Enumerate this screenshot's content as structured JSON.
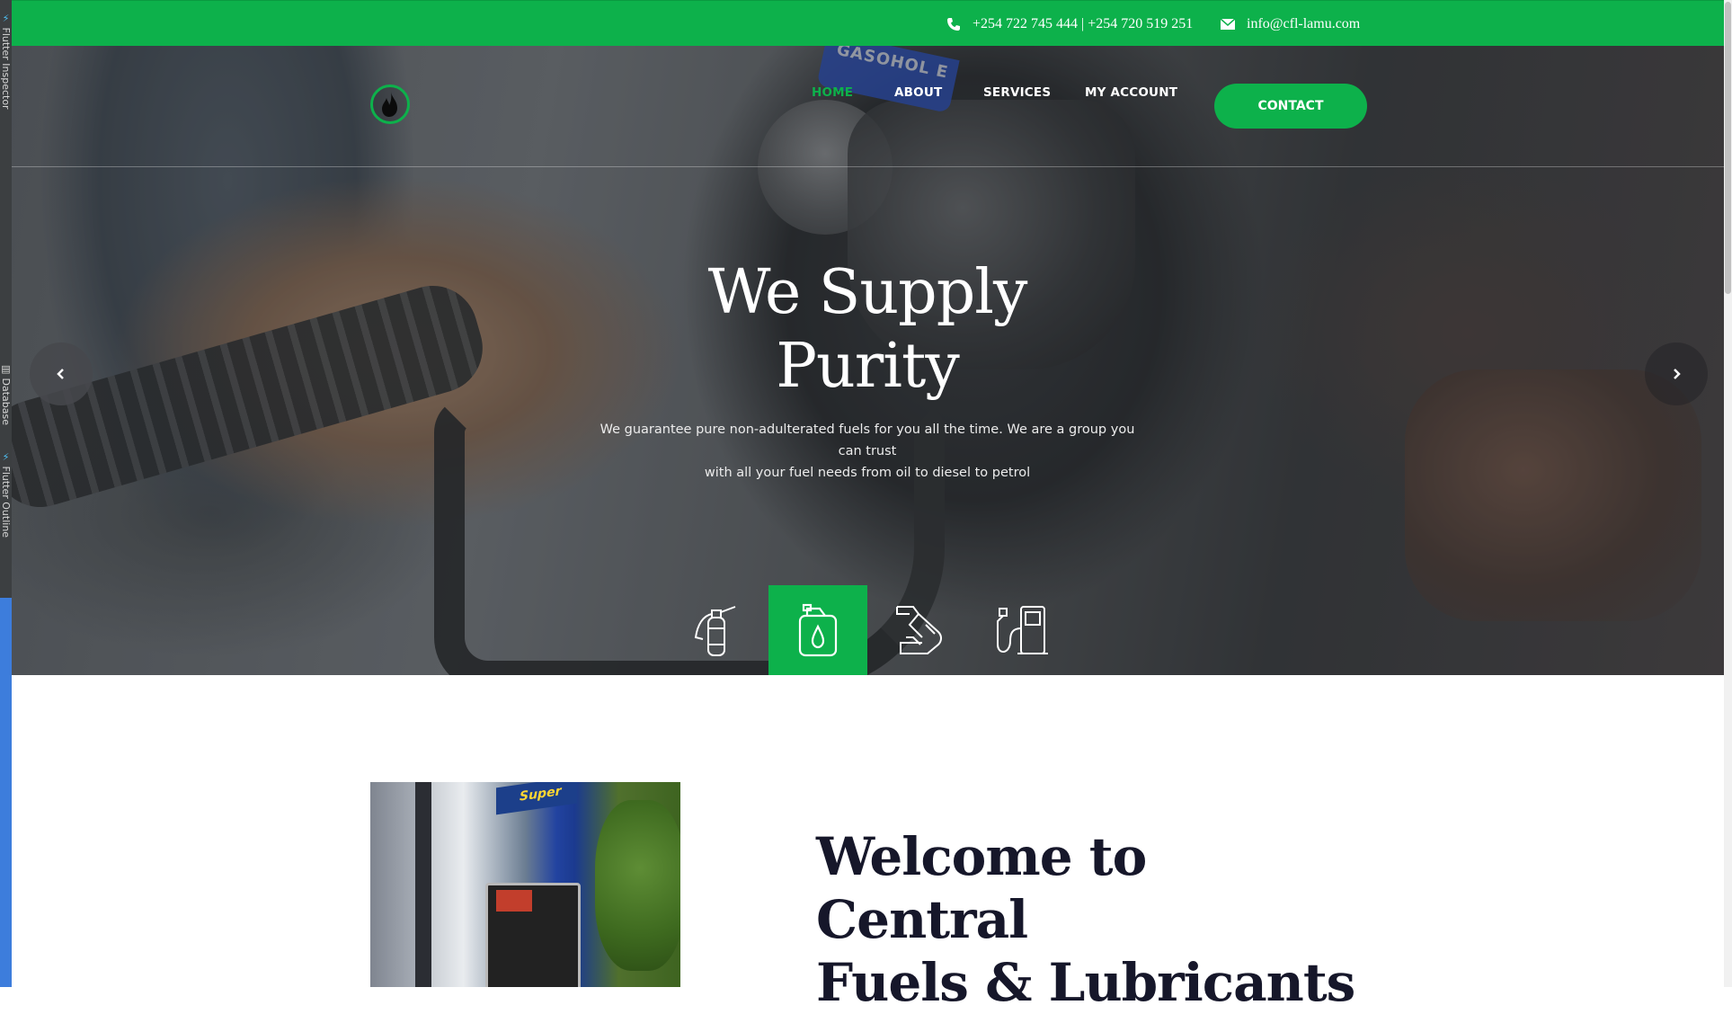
{
  "devtools": {
    "tabs": [
      "Flutter Inspector",
      "Database",
      "Flutter Outline"
    ]
  },
  "topbar": {
    "phone": "+254 722 745 444 | +254 720 519 251",
    "email": "info@cfl-lamu.com",
    "phone_icon": "phone-icon",
    "email_icon": "envelope-icon"
  },
  "nav": {
    "items": [
      {
        "label": "HOME",
        "active": true
      },
      {
        "label": "ABOUT",
        "active": false
      },
      {
        "label": "SERVICES",
        "active": false
      },
      {
        "label": "MY ACCOUNT",
        "active": false
      }
    ],
    "contact_label": "CONTACT"
  },
  "hero": {
    "title_line1": "We Supply",
    "title_line2": "Purity",
    "subtitle_line1": "We guarantee pure non-adulterated fuels for you all the time. We are a group you can trust",
    "subtitle_line2": "with all your fuel needs from oil to diesel to petrol",
    "pump_sign": "GASOHOL E",
    "services": [
      {
        "icon": "fire-extinguisher-icon",
        "active": false
      },
      {
        "icon": "oil-canister-icon",
        "active": true
      },
      {
        "icon": "fuel-nozzle-icon",
        "active": false
      },
      {
        "icon": "gas-pump-icon",
        "active": false
      }
    ]
  },
  "welcome": {
    "title_line1": "Welcome to Central",
    "title_line2": "Fuels & Lubricants",
    "image_sign": "Super"
  },
  "colors": {
    "brand_green": "#0db14b",
    "heading_dark": "#16172a"
  }
}
